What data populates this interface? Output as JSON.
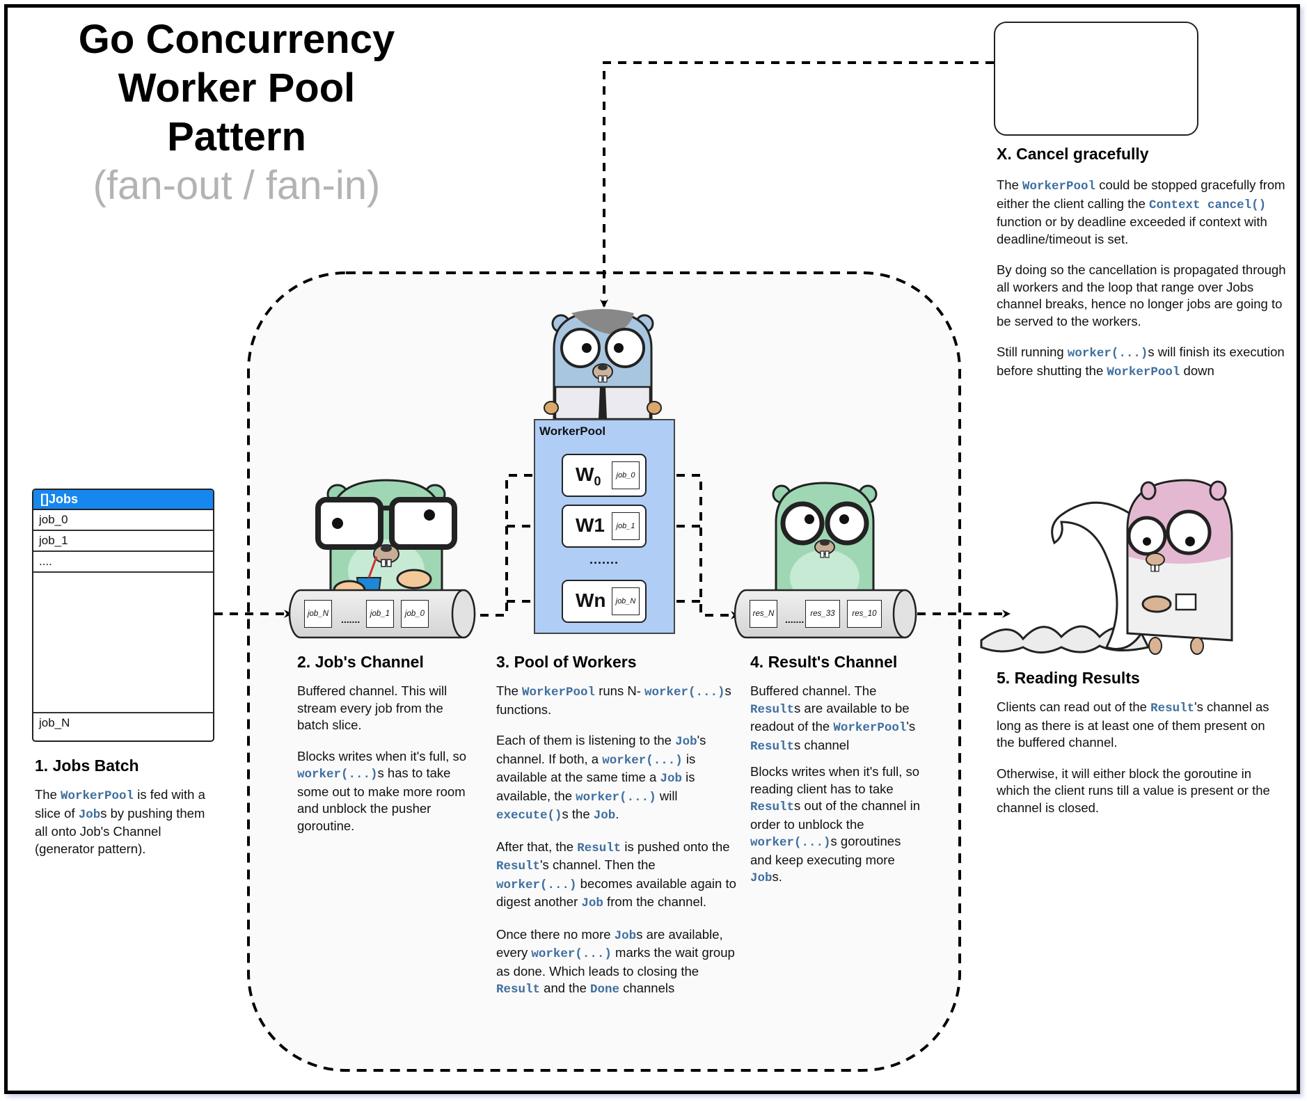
{
  "header": {
    "title_line1": "Go Concurrency",
    "title_line2": "Worker Pool",
    "title_line3": "Pattern",
    "subtitle": "(fan-out / fan-in)"
  },
  "colors": {
    "code_accent": "#3f6f9f",
    "jobs_header": "#1687ef",
    "pool_fill": "#b0cdf5",
    "subtitle_gray": "#b3b3b3",
    "cancel_red": "#d32f2f",
    "warning_orange": "#f08a1c"
  },
  "jobs_table": {
    "header": "[]Jobs",
    "rows": [
      "job_0",
      "job_1",
      "...."
    ],
    "last_row": "job_N"
  },
  "jobs_channel": {
    "slots": [
      "job_N",
      "job_1",
      "job_0"
    ],
    "ellipsis": "......."
  },
  "worker_pool": {
    "label": "WorkerPool",
    "workers": [
      {
        "name": "W",
        "sub": "0",
        "job": "job_0"
      },
      {
        "name": "W1",
        "sub": "",
        "job": "job_1"
      },
      {
        "name": "Wn",
        "sub": "",
        "job": "job_N"
      }
    ],
    "ellipsis": "......."
  },
  "results_channel": {
    "slots": [
      "res_N",
      "res_33",
      "res_10"
    ],
    "ellipsis": "......."
  },
  "sections": {
    "s1": {
      "heading": "1. Jobs Batch",
      "p1": [
        {
          "t": "The "
        },
        {
          "c": "WorkerPool"
        },
        {
          "t": " is fed with a slice of "
        },
        {
          "c": "Job"
        },
        {
          "t": "s by pushing them all onto Job's Channel (generator pattern)."
        }
      ]
    },
    "s2": {
      "heading": "2. Job's Channel",
      "p1": [
        {
          "t": "Buffered channel. This will stream every job from the batch slice."
        }
      ],
      "p2": [
        {
          "t": "Blocks writes when it's full, so "
        },
        {
          "c": "worker(...)"
        },
        {
          "t": "s has to take some out to make more room and unblock the pusher goroutine."
        }
      ]
    },
    "s3": {
      "heading": "3. Pool of Workers",
      "p1": [
        {
          "t": "The "
        },
        {
          "c": "WorkerPool"
        },
        {
          "t": " runs N- "
        },
        {
          "c": "worker(...)"
        },
        {
          "t": "s functions."
        }
      ],
      "p2": [
        {
          "t": "Each of them is listening to the "
        },
        {
          "c": "Job"
        },
        {
          "t": "'s channel. If both, a "
        },
        {
          "c": "worker(...)"
        },
        {
          "t": " is available at the same time a "
        },
        {
          "c": "Job"
        },
        {
          "t": " is available, the "
        },
        {
          "c": "worker(...)"
        },
        {
          "t": "  will  "
        },
        {
          "c": "execute()"
        },
        {
          "t": "s the "
        },
        {
          "c": "Job"
        },
        {
          "t": "."
        }
      ],
      "p3": [
        {
          "t": "After that, the "
        },
        {
          "c": "Result"
        },
        {
          "t": " is pushed onto the "
        },
        {
          "c": "Result"
        },
        {
          "t": "'s channel. Then the "
        },
        {
          "c": "worker(...)"
        },
        {
          "t": " becomes available again to digest another "
        },
        {
          "c": "Job"
        },
        {
          "t": "  from the channel."
        }
      ],
      "p4": [
        {
          "t": "Once there no more "
        },
        {
          "c": "Job"
        },
        {
          "t": "s are available, every "
        },
        {
          "c": "worker(...)"
        },
        {
          "t": " marks the wait group as done. Which leads to closing the "
        },
        {
          "c": "Result"
        },
        {
          "t": " and the "
        },
        {
          "c": "Done"
        },
        {
          "t": " channels"
        }
      ]
    },
    "s4": {
      "heading": "4. Result's Channel",
      "p1": [
        {
          "t": "Buffered channel. The "
        },
        {
          "c": "Result"
        },
        {
          "t": "s are available to be readout of the "
        },
        {
          "c": "WorkerPool"
        },
        {
          "t": "'s "
        },
        {
          "c": "Result"
        },
        {
          "t": "s channel"
        }
      ],
      "p2": [
        {
          "t": "Blocks writes when it's full, so reading client has to take "
        },
        {
          "c": "Result"
        },
        {
          "t": "s out of the channel in order to unblock the "
        },
        {
          "c": "worker(...)"
        },
        {
          "t": "s goroutines and keep executing more "
        },
        {
          "c": "Job"
        },
        {
          "t": "s."
        }
      ]
    },
    "s5": {
      "heading": "5. Reading Results",
      "p1": [
        {
          "t": "Clients can read out of the "
        },
        {
          "c": "Result"
        },
        {
          "t": "'s channel as long as there is at least one of them present on the buffered channel."
        }
      ],
      "p2": [
        {
          "t": "Otherwise, it will either block the goroutine in which the client runs till a value is present or the channel is closed."
        }
      ]
    },
    "sx": {
      "heading": "X. Cancel gracefully",
      "p1": [
        {
          "t": "The "
        },
        {
          "c": "WorkerPool"
        },
        {
          "t": " could be stopped gracefully from either the client calling the "
        },
        {
          "c": "Context cancel()"
        },
        {
          "t": " function or by deadline exceeded if context with deadline/timeout is set."
        }
      ],
      "p2": [
        {
          "t": "By doing so the cancellation is propagated through all workers and the loop that range over Jobs channel breaks, hence no longer jobs are going to be served to the workers."
        }
      ],
      "p3": [
        {
          "t": "Still running "
        },
        {
          "c": "worker(...)"
        },
        {
          "t": "s will finish its execution before shutting the "
        },
        {
          "c": "WorkerPool"
        },
        {
          "t": " down"
        }
      ]
    }
  },
  "icons": {
    "clock": "timeout-clock-icon",
    "stop": "stop-hand-icon"
  }
}
